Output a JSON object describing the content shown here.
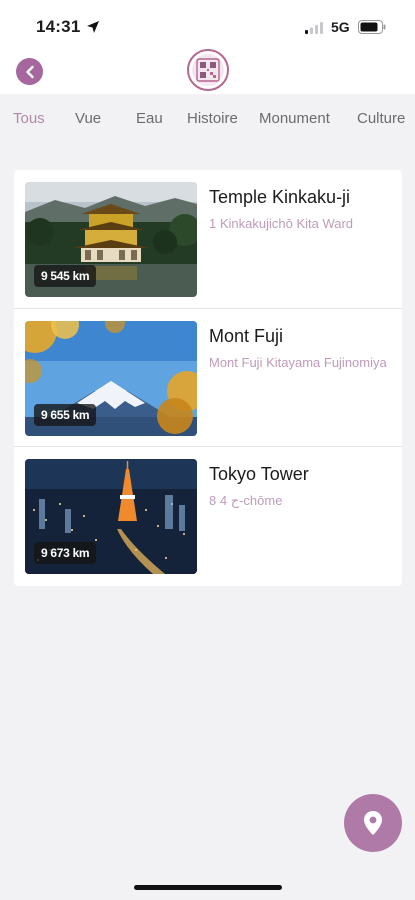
{
  "status_bar": {
    "time": "14:31",
    "network": "5G"
  },
  "tabs": [
    {
      "label": "Tous",
      "active": true
    },
    {
      "label": "Vue",
      "active": false
    },
    {
      "label": "Eau",
      "active": false
    },
    {
      "label": "Histoire",
      "active": false
    },
    {
      "label": "Monument",
      "active": false
    },
    {
      "label": "Culture",
      "active": false
    }
  ],
  "places": [
    {
      "title": "Temple Kinkaku-ji",
      "address": "1 Kinkakujichō Kita Ward",
      "distance": "9 545 km",
      "image": "golden-pavilion-photo"
    },
    {
      "title": "Mont Fuji",
      "address": "Mont Fuji Kitayama Fujinomiya",
      "distance": "9 655 km",
      "image": "mount-fuji-photo"
    },
    {
      "title": "Tokyo Tower",
      "address": "8 ح 4-chōme",
      "distance": "9 673 km",
      "image": "tokyo-night-photo"
    }
  ],
  "colors": {
    "accent": "#a6679e",
    "subtitle": "#bf9bba",
    "active_tab": "#b08aa9"
  },
  "icons": {
    "back": "chevron-left-icon",
    "map": "map-pin-icon",
    "location": "location-arrow-icon"
  }
}
